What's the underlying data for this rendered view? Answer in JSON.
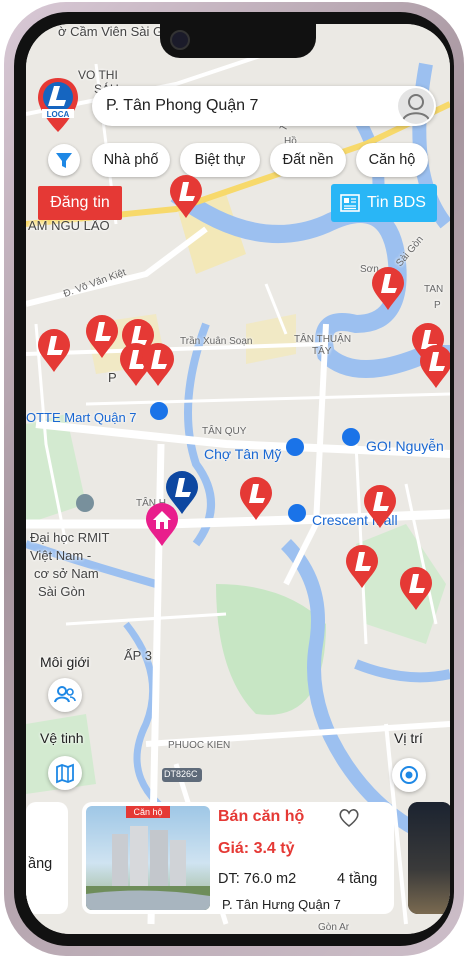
{
  "search": {
    "location": "P. Tân Phong Quận 7"
  },
  "filters": [
    "Nhà phố",
    "Biệt thự",
    "Đất nền",
    "Căn hộ"
  ],
  "actions": {
    "post": "Đăng tin",
    "news": "Tin BDS"
  },
  "map_labels": {
    "cam_vien": "ờ Cầm Viên Sài Gò",
    "vo_thi": "VO THI",
    "thi_sau": "SÁU",
    "pham_ngu_lao": "AM NGŨ LÃO",
    "vo_van_kiet": "Đ. Võ Văn Kiệt",
    "tran_xuan_soan": "Trần Xuân Soạn",
    "tan_thuan_tay_1": "TÂN THUẬN",
    "tan_thuan_tay_2": "TÂY",
    "lotte": "OTTE Mart Quận 7",
    "tan_quy": "TÂN QUY",
    "cho_tan_my": "Chợ Tân Mỹ",
    "go_nguyen": "GO! Nguyễn",
    "crescent": "Crescent Mall",
    "rmit_1": "Đại học RMIT",
    "rmit_2": "Việt Nam -",
    "rmit_3": "cơ sở Nam",
    "rmit_4": "Sài Gòn",
    "tan_hung": "TÂN H",
    "ap3": "ẤP 3",
    "phuoc_kien": "PHUOC KIEN",
    "dt826c": "DT826C",
    "p_label": "P",
    "to": "Tô",
    "ho": "Hồ",
    "son": "Sơn",
    "tan": "TAN",
    "p_right": "P",
    "saigon": "Sài Gòn",
    "gon_bottom": "Gòn Ar"
  },
  "controls": {
    "broker": "Môi giới",
    "satellite": "Vệ tinh",
    "location": "Vị trí"
  },
  "cards": {
    "main": {
      "tag": "Căn hộ",
      "title": "Bán căn hộ",
      "price": "Giá: 3.4 tỷ",
      "area": "DT: 76.0 m2",
      "floors": "4 tầng",
      "location": "P. Tân Hưng Quận 7"
    },
    "left_partial": {
      "floors": "ầng"
    }
  },
  "colors": {
    "accent": "#e53935",
    "info": "#29b6f6",
    "pin_blue": "#0d47a1"
  }
}
